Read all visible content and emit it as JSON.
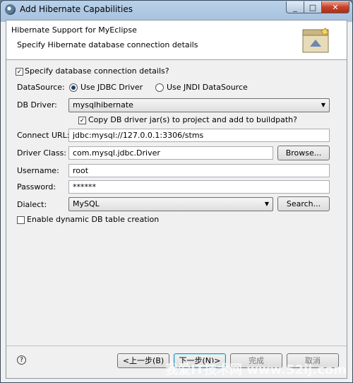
{
  "window": {
    "title": "Add Hibernate Capabilities"
  },
  "header": {
    "title": "Hibernate Support for MyEclipse",
    "description": "Specify Hibernate database connection details"
  },
  "form": {
    "specify_label": "Specify database connection details?",
    "specify_checked": true,
    "datasource_label": "DataSource:",
    "jdbc_option": "Use JDBC Driver",
    "jndi_option": "Use JNDI DataSource",
    "driver_label": "DB Driver:",
    "driver_value": "mysqlhibernate",
    "copy_label": "Copy DB driver jar(s) to project and add to buildpath?",
    "connect_url_label": "Connect URL:",
    "connect_url_value": "jdbc:mysql://127.0.0.1:3306/stms",
    "driver_class_label": "Driver Class:",
    "driver_class_value": "com.mysql.jdbc.Driver",
    "browse_label": "Browse...",
    "username_label": "Username:",
    "username_value": "root",
    "password_label": "Password:",
    "password_value": "******",
    "dialect_label": "Dialect:",
    "dialect_value": "MySQL",
    "search_label": "Search...",
    "enable_label": "Enable dynamic DB table creation"
  },
  "footer": {
    "back_label": "<上一步(B)",
    "next_label": "下一步(N)>",
    "finish_label": "完成",
    "cancel_label": "取消"
  },
  "watermark": "我爱IT技术网 www.52ij.com"
}
